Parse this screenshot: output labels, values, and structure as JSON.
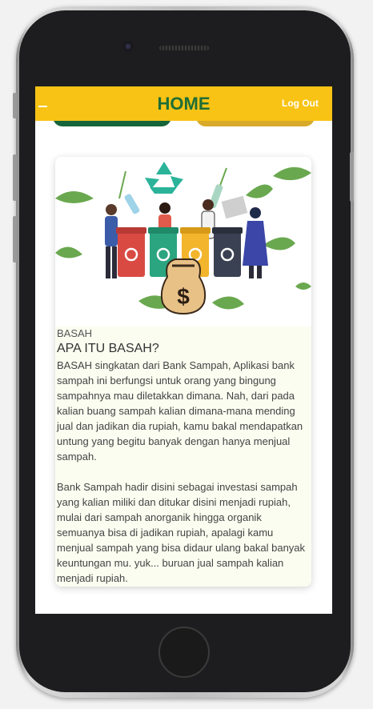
{
  "header": {
    "title": "HOME",
    "logout_label": "Log Out"
  },
  "card": {
    "label": "BASAH",
    "heading": "APA ITU BASAH?",
    "paragraph1": "BASAH singkatan dari Bank Sampah, Aplikasi bank sampah ini berfungsi untuk orang yang bingung sampahnya mau diletakkan dimana. Nah, dari pada kalian buang sampah kalian dimana-mana mending jual dan jadikan dia rupiah, kamu bakal mendapatkan untung yang begitu banyak dengan hanya menjual sampah.",
    "paragraph2": "Bank Sampah hadir disini sebagai investasi sampah yang kalian miliki dan ditukar disini menjadi rupiah, mulai dari sampah anorganik hingga organik semuanya bisa di jadikan rupiah, apalagi kamu menjual sampah yang bisa didaur ulang bakal banyak keuntungan mu. yuk... buruan jual sampah kalian menjadi rupiah.",
    "money_bag_symbol": "$"
  },
  "colors": {
    "header_bg": "#f8c314",
    "title_green": "#1f6e36",
    "pill_green": "#16653a",
    "pill_yellow": "#d8aa2a",
    "text_bg": "#fafdf0"
  },
  "icons": {
    "menu": "hamburger-icon",
    "recycle": "recycle-icon"
  }
}
